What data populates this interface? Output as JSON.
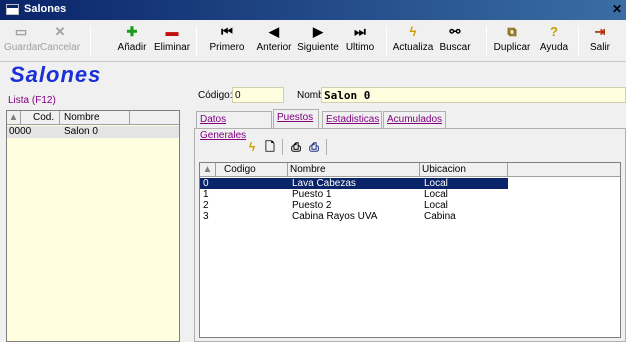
{
  "window": {
    "title": "Salones",
    "close_glyph": "✕"
  },
  "toolbar": {
    "buttons": [
      {
        "label": "Guardar",
        "icon": "save-icon"
      },
      {
        "label": "Cancelar",
        "icon": "cancel-icon"
      },
      {
        "label": "Añadir",
        "icon": "add-icon"
      },
      {
        "label": "Eliminar",
        "icon": "delete-icon"
      },
      {
        "label": "Primero",
        "icon": "first-icon"
      },
      {
        "label": "Anterior",
        "icon": "previous-icon"
      },
      {
        "label": "Siguiente",
        "icon": "next-icon"
      },
      {
        "label": "Ultimo",
        "icon": "last-icon"
      },
      {
        "label": "Actualiza",
        "icon": "refresh-icon"
      },
      {
        "label": "Buscar",
        "icon": "binoculars-icon"
      },
      {
        "label": "Duplicar",
        "icon": "duplicate-icon"
      },
      {
        "label": "Ayuda",
        "icon": "help-icon"
      },
      {
        "label": "Salir",
        "icon": "exit-icon"
      }
    ]
  },
  "page": {
    "heading": "Salones",
    "list_label": "Lista (F12)"
  },
  "form": {
    "codigo_label": "Código:",
    "codigo_value": "0",
    "nombre_label": "Nombre:",
    "nombre_value": "Salon 0"
  },
  "left_list": {
    "columns": [
      "Cod.",
      "Nombre"
    ],
    "rows": [
      {
        "cod": "0000",
        "nombre": "Salon 0"
      }
    ]
  },
  "tabs": [
    {
      "label": "Datos Generales"
    },
    {
      "label": "Puestos"
    },
    {
      "label": "Estadisticas"
    },
    {
      "label": "Acumulados"
    }
  ],
  "subtoolbar": {
    "icons": [
      "refresh-icon",
      "preview-icon",
      "print-icon",
      "print-setup-icon"
    ]
  },
  "puestos_grid": {
    "columns": [
      "Codigo",
      "Nombre",
      "Ubicacion"
    ],
    "rows": [
      {
        "codigo": "0",
        "nombre": "Lava Cabezas",
        "ubicacion": "Local"
      },
      {
        "codigo": "1",
        "nombre": "Puesto 1",
        "ubicacion": "Local"
      },
      {
        "codigo": "2",
        "nombre": "Puesto 2",
        "ubicacion": "Local"
      },
      {
        "codigo": "3",
        "nombre": "Cabina Rayos UVA",
        "ubicacion": "Cabina"
      }
    ],
    "selected_index": 0
  },
  "colors": {
    "title_bar": "#0a246a",
    "heading": "#1a2fd6",
    "field_bg": "#ffffe0",
    "selection": "#0a246a",
    "tab_text": "#800080"
  }
}
